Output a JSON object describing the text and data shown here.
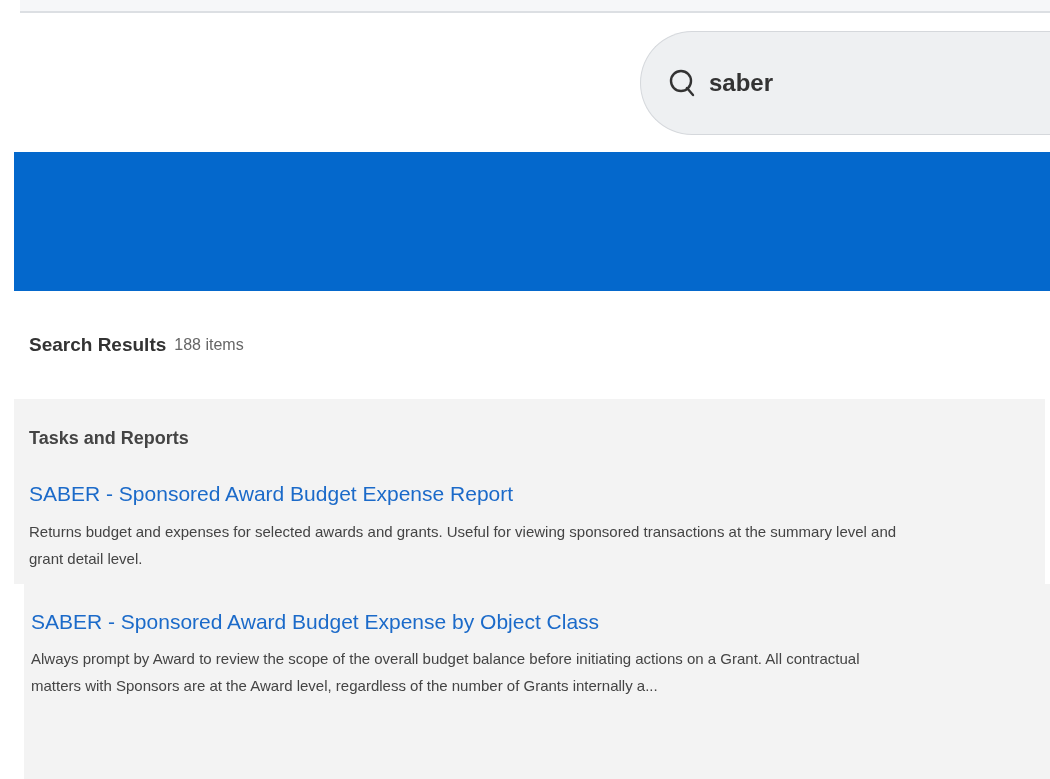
{
  "search": {
    "value": "saber"
  },
  "results": {
    "title": "Search Results",
    "count": "188 items"
  },
  "section": {
    "title": "Tasks and Reports"
  },
  "items": [
    {
      "title": "SABER - Sponsored Award Budget Expense Report",
      "description": "Returns budget and expenses for selected awards and grants. Useful for viewing sponsored transactions at the summary level and grant detail level."
    },
    {
      "title": "SABER - Sponsored Award Budget Expense by Object Class",
      "description": "Always prompt by Award to review the scope of the overall budget balance before initiating actions on a Grant. All contractual matters with Sponsors are at the Award level, regardless of the number of Grants internally a..."
    }
  ]
}
